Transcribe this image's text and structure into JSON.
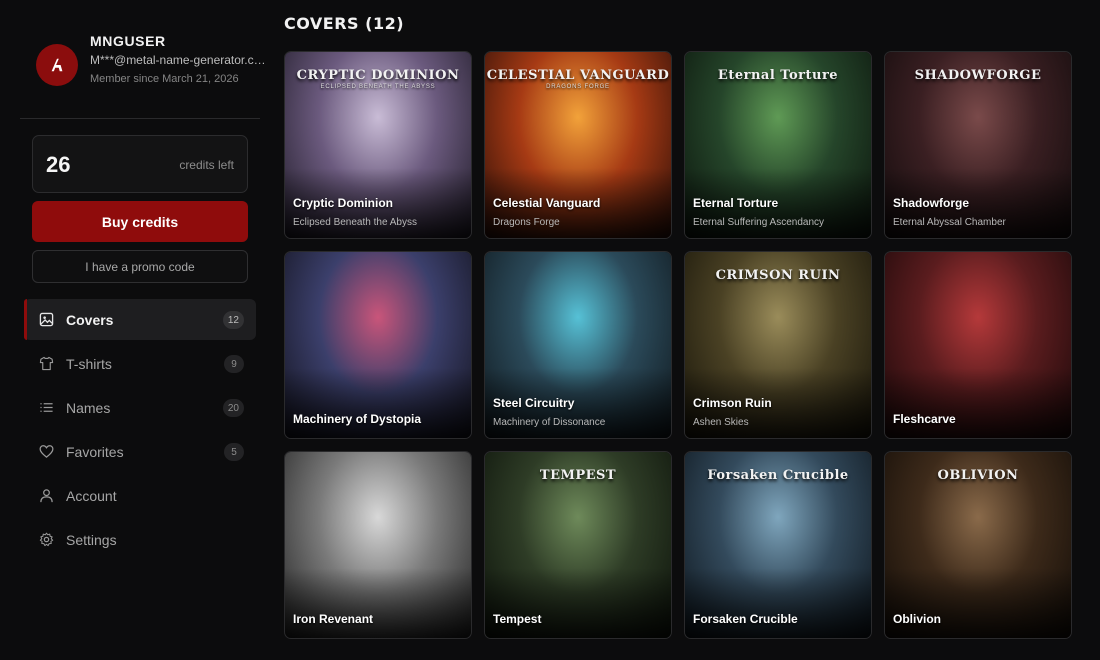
{
  "user": {
    "name": "MNGUSER",
    "email": "M***@metal-name-generator.com",
    "member_since": "Member since March 21, 2026"
  },
  "credits": {
    "count": "26",
    "label": "credits left",
    "buy_label": "Buy credits",
    "promo_label": "I have a promo code"
  },
  "nav": [
    {
      "label": "Covers",
      "count": "12",
      "icon": "image-icon",
      "active": true
    },
    {
      "label": "T-shirts",
      "count": "9",
      "icon": "tshirt-icon"
    },
    {
      "label": "Names",
      "count": "20",
      "icon": "list-icon"
    },
    {
      "label": "Favorites",
      "count": "5",
      "icon": "heart-icon"
    },
    {
      "label": "Account",
      "icon": "user-icon"
    },
    {
      "label": "Settings",
      "icon": "gear-icon"
    }
  ],
  "main": {
    "title": "COVERS (12)"
  },
  "covers": [
    {
      "art_title": "CRYPTIC DOMINION",
      "art_sub": "ECLIPSED BENEATH THE ABYSS",
      "title": "Cryptic Dominion",
      "subtitle": "Eclipsed Beneath the Abyss",
      "palette": [
        "#c9bcd6",
        "#6b5a7e",
        "#1e1a26"
      ]
    },
    {
      "art_title": "CELESTIAL VANGUARD",
      "art_sub": "DRAGONS FORGE",
      "title": "Celestial Vanguard",
      "subtitle": "Dragons Forge",
      "palette": [
        "#f2a23a",
        "#a63a14",
        "#2a0e08"
      ]
    },
    {
      "art_title": "Eternal Torture",
      "art_sub": "",
      "title": "Eternal Torture",
      "subtitle": "Eternal Suffering Ascendancy",
      "palette": [
        "#5f9a55",
        "#25452a",
        "#0b140c"
      ]
    },
    {
      "art_title": "SHADOWFORGE",
      "art_sub": "",
      "title": "Shadowforge",
      "subtitle": "Eternal Abyssal Chamber",
      "palette": [
        "#7a4a4a",
        "#3a1f22",
        "#120b0c"
      ]
    },
    {
      "art_title": "",
      "art_sub": "",
      "title": "Machinery of Dystopia",
      "subtitle": "",
      "palette": [
        "#c9557a",
        "#3b3f6b",
        "#12121c"
      ]
    },
    {
      "art_title": "",
      "art_sub": "",
      "title": "Steel Circuitry",
      "subtitle": "Machinery of Dissonance",
      "palette": [
        "#56c1d6",
        "#2b4a5a",
        "#0f171c"
      ]
    },
    {
      "art_title": "CRIMSON RUIN",
      "art_sub": "",
      "title": "Crimson Ruin",
      "subtitle": "Ashen Skies",
      "palette": [
        "#9a8c5a",
        "#4a4124",
        "#171409"
      ]
    },
    {
      "art_title": "",
      "art_sub": "",
      "title": "Fleshcarve",
      "subtitle": "",
      "palette": [
        "#b5393a",
        "#5a1c1e",
        "#1a0809"
      ]
    },
    {
      "art_title": "",
      "art_sub": "",
      "title": "Iron Revenant",
      "subtitle": "",
      "palette": [
        "#d8d8d8",
        "#7a7a7a",
        "#222222"
      ]
    },
    {
      "art_title": "TEMPEST",
      "art_sub": "",
      "title": "Tempest",
      "subtitle": "",
      "palette": [
        "#6e8a5a",
        "#2e3c26",
        "#0c120a"
      ]
    },
    {
      "art_title": "Forsaken Crucible",
      "art_sub": "",
      "title": "Forsaken Crucible",
      "subtitle": "",
      "palette": [
        "#7fa6bd",
        "#334a5c",
        "#0d151c"
      ]
    },
    {
      "art_title": "OBLIVION",
      "art_sub": "",
      "title": "Oblivion",
      "subtitle": "",
      "palette": [
        "#8a6a4a",
        "#3d2a1a",
        "#120c07"
      ]
    }
  ],
  "colors": {
    "accent": "#8f0c0c",
    "background": "#0c0c0d",
    "surface": "#1e1e20"
  }
}
